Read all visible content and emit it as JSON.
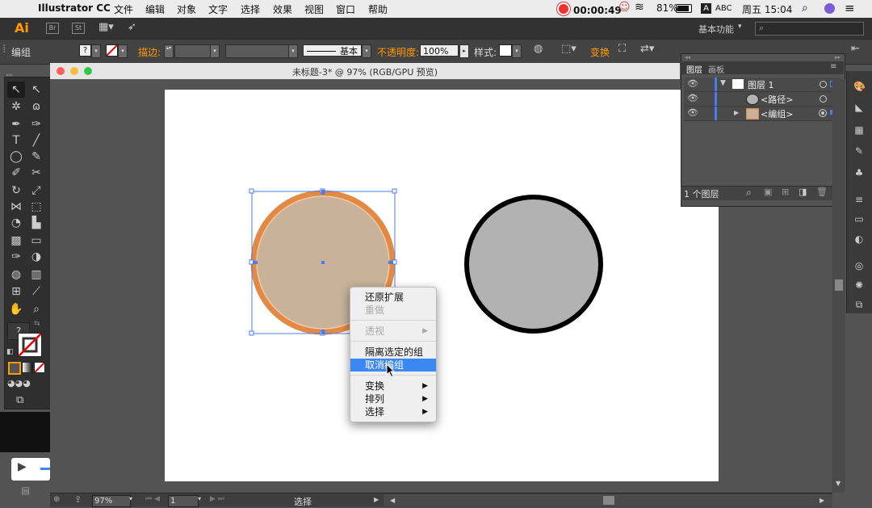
{
  "menubar": {
    "app_name": "Illustrator CC",
    "items": [
      "文件",
      "编辑",
      "对象",
      "文字",
      "选择",
      "效果",
      "视图",
      "窗口",
      "帮助"
    ],
    "recording_time": "00:00:49",
    "battery": "81%",
    "input_badge": "A",
    "input_method": "ABC",
    "clock": "周五 15:04"
  },
  "appbar": {
    "logo": "Ai",
    "bridge": "Br",
    "stock": "St",
    "workspace": "基本功能"
  },
  "control_bar": {
    "selection_type": "编组",
    "fill_value": "?",
    "stroke_label": "描边:",
    "brush_label": "基本",
    "opacity_label": "不透明度:",
    "opacity_value": "100%",
    "style_label": "样式:",
    "transform_label": "变换"
  },
  "document": {
    "title": "未标题-3* @ 97% (RGB/GPU 预览)"
  },
  "context_menu": {
    "items": [
      {
        "label": "还原扩展",
        "enabled": true
      },
      {
        "label": "重做",
        "enabled": false
      },
      {
        "label": "透视",
        "enabled": false,
        "submenu": true
      },
      {
        "label": "隔离选定的组",
        "enabled": true
      },
      {
        "label": "取消编组",
        "enabled": true,
        "highlighted": true
      },
      {
        "label": "变换",
        "enabled": true,
        "submenu": true
      },
      {
        "label": "排列",
        "enabled": true,
        "submenu": true
      },
      {
        "label": "选择",
        "enabled": true,
        "submenu": true
      }
    ]
  },
  "layers_panel": {
    "tabs": [
      "图层",
      "画板"
    ],
    "rows": [
      {
        "name": "图层 1"
      },
      {
        "name": "<路径>"
      },
      {
        "name": "<编组>"
      }
    ],
    "footer": "1 个图层"
  },
  "statusbar": {
    "zoom": "97%",
    "artboard": "1",
    "tool": "选择"
  },
  "colors": {
    "accent": "#ff9a00",
    "selection": "#4a7cf0",
    "highlight": "#3b87f3",
    "circle_left_fill": "#c8b29a",
    "circle_left_stroke": "#e28a45",
    "circle_right_fill": "#b2b2b2"
  }
}
